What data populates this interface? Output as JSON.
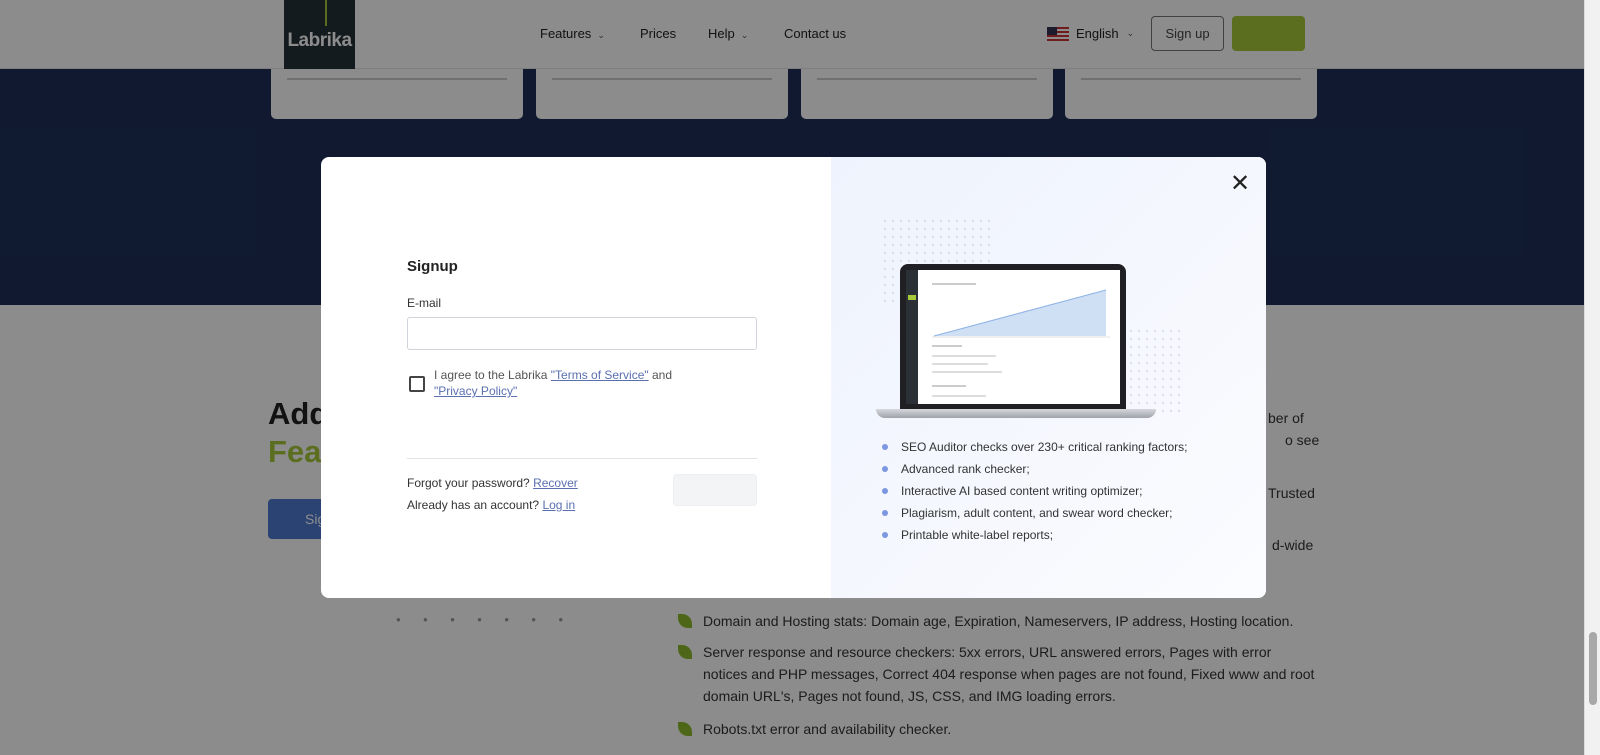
{
  "nav": {
    "logo": "Labrika",
    "items": [
      "Features",
      "Prices",
      "Help",
      "Contact us"
    ],
    "language": "English",
    "signup_label": "Sign up"
  },
  "background": {
    "title_line1": "Add",
    "title_line2": "Fea",
    "button_label": "Sig",
    "right_fragments": [
      "ber of",
      "o see",
      "Trusted",
      "d-wide"
    ],
    "features": [
      "Domain and Hosting stats: Domain age, Expiration, Nameservers, IP address, Hosting location.",
      "Server response and resource checkers: 5xx errors, URL answered errors, Pages with error notices and PHP messages, Correct 404 response when pages are not found, Fixed www and root domain URL's, Pages not found, JS, CSS, and IMG loading errors.",
      "Robots.txt error and availability checker."
    ]
  },
  "modal": {
    "title": "Signup",
    "email_label": "E-mail",
    "email_value": "",
    "email_placeholder": "",
    "agree_prefix": "I agree to the Labrika",
    "terms_link": "\"Terms of Service\"",
    "agree_middle": "and",
    "privacy_link": "\"Privacy Policy\"",
    "forgot_text": "Forgot your password?",
    "recover_link": "Recover",
    "already_text": "Already has an account?",
    "login_link": "Log in",
    "submit_label": "",
    "close_icon": "close-icon",
    "bullets": [
      "SEO Auditor checks over 230+ critical ranking factors;",
      "Advanced rank checker;",
      "Interactive AI based content writing optimizer;",
      "Plagiarism, adult content, and swear word checker;",
      "Printable white-label reports;"
    ]
  },
  "colors": {
    "accent_green": "#a6c93a",
    "navy": "#1e2f58",
    "link": "#5a6fb0",
    "bullet": "#7c97e0"
  }
}
